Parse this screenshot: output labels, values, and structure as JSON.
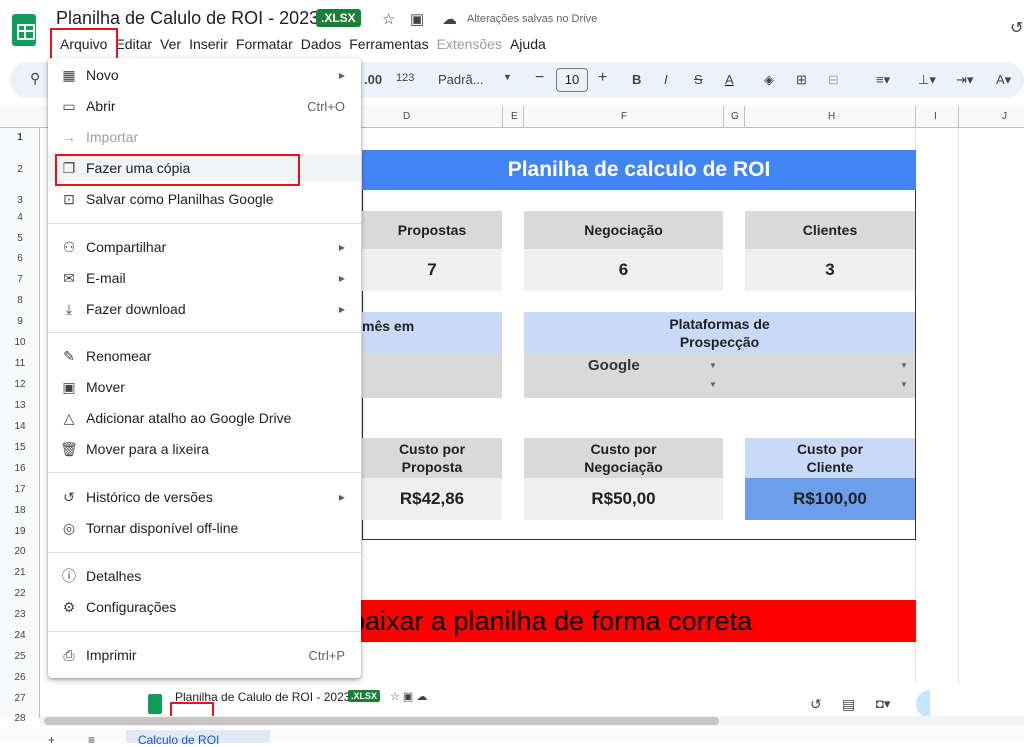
{
  "titlebar": {
    "doc_title": "Planilha de Calulo de ROI - 2023",
    "badge": ".XLSX",
    "saved_status": "Alterações salvas no Drive",
    "icons": [
      "star-icon",
      "folder-move-icon",
      "cloud-done-icon"
    ]
  },
  "menubar": {
    "items": [
      "Arquivo",
      "Editar",
      "Ver",
      "Inserir",
      "Formatar",
      "Dados",
      "Ferramentas",
      "Extensões",
      "Ajuda"
    ]
  },
  "toolbar": {
    "decimal_label": ".00",
    "number_format": "123",
    "font_name": "Padrã...",
    "font_size": "10",
    "bold": "B",
    "italic": "I",
    "strike": "S",
    "text_color": "A"
  },
  "columns": [
    "D",
    "E",
    "F",
    "G",
    "H",
    "I",
    "J"
  ],
  "rows": [
    "1",
    "2",
    "3",
    "4",
    "5",
    "6",
    "7",
    "8",
    "9",
    "10",
    "11",
    "12",
    "13",
    "14",
    "15",
    "16",
    "17",
    "18",
    "19",
    "20",
    "21",
    "22",
    "23",
    "24",
    "25",
    "26",
    "27",
    "28"
  ],
  "sheet": {
    "banner_title": "Planilha de calculo de ROI",
    "stats": [
      {
        "label": "Propostas",
        "value": "7"
      },
      {
        "label": "Negociação",
        "value": "6"
      },
      {
        "label": "Clientes",
        "value": "3"
      }
    ],
    "month_partial": "mês em",
    "platforms_label": "Plataformas de Prospecção",
    "platform_value": "Google",
    "costs": [
      {
        "label": "Custo por Proposta",
        "value": "R$42,86"
      },
      {
        "label": "Custo por Negociação",
        "value": "R$50,00"
      },
      {
        "label": "Custo por Cliente",
        "value": "R$100,00"
      }
    ],
    "red_banner": "baixar a planilha de forma correta"
  },
  "file_menu": {
    "items": [
      {
        "icon": "new-sheet-icon",
        "label": "Novo",
        "shortcut": "",
        "submenu": true,
        "disabled": false
      },
      {
        "icon": "folder-open-icon",
        "label": "Abrir",
        "shortcut": "Ctrl+O",
        "submenu": false,
        "disabled": false
      },
      {
        "icon": "import-icon",
        "label": "Importar",
        "shortcut": "",
        "submenu": false,
        "disabled": true
      },
      {
        "icon": "copy-icon",
        "label": "Fazer uma cópia",
        "shortcut": "",
        "submenu": false,
        "disabled": false
      },
      {
        "icon": "save-sheets-icon",
        "label": "Salvar como Planilhas Google",
        "shortcut": "",
        "submenu": false,
        "disabled": false
      },
      {
        "icon": "share-icon",
        "label": "Compartilhar",
        "shortcut": "",
        "submenu": true,
        "disabled": false
      },
      {
        "icon": "email-icon",
        "label": "E-mail",
        "shortcut": "",
        "submenu": true,
        "disabled": false
      },
      {
        "icon": "download-icon",
        "label": "Fazer download",
        "shortcut": "",
        "submenu": true,
        "disabled": false
      },
      {
        "icon": "rename-icon",
        "label": "Renomear",
        "shortcut": "",
        "submenu": false,
        "disabled": false
      },
      {
        "icon": "move-icon",
        "label": "Mover",
        "shortcut": "",
        "submenu": false,
        "disabled": false
      },
      {
        "icon": "drive-shortcut-icon",
        "label": "Adicionar atalho ao Google Drive",
        "shortcut": "",
        "submenu": false,
        "disabled": false
      },
      {
        "icon": "trash-icon",
        "label": "Mover para a lixeira",
        "shortcut": "",
        "submenu": false,
        "disabled": false
      },
      {
        "icon": "history-icon",
        "label": "Histórico de versões",
        "shortcut": "",
        "submenu": true,
        "disabled": false
      },
      {
        "icon": "offline-icon",
        "label": "Tornar disponível off-line",
        "shortcut": "",
        "submenu": false,
        "disabled": false
      },
      {
        "icon": "info-icon",
        "label": "Detalhes",
        "shortcut": "",
        "submenu": false,
        "disabled": false
      },
      {
        "icon": "settings-icon",
        "label": "Configurações",
        "shortcut": "",
        "submenu": false,
        "disabled": false
      },
      {
        "icon": "print-icon",
        "label": "Imprimir",
        "shortcut": "Ctrl+P",
        "submenu": false,
        "disabled": false
      }
    ]
  },
  "embedded_screenshot": {
    "doc_title": "Planilha de Calulo de ROI - 2023",
    "badge": ".XLSX"
  },
  "sheet_tab": "Calculo de ROI",
  "colors": {
    "banner_blue": "#4285f4",
    "light_blue": "#c9daf8",
    "mid_blue": "#6d9eeb",
    "grey_header": "#d9d9d9",
    "red": "#ff0000",
    "highlight_red": "#e3121b"
  }
}
